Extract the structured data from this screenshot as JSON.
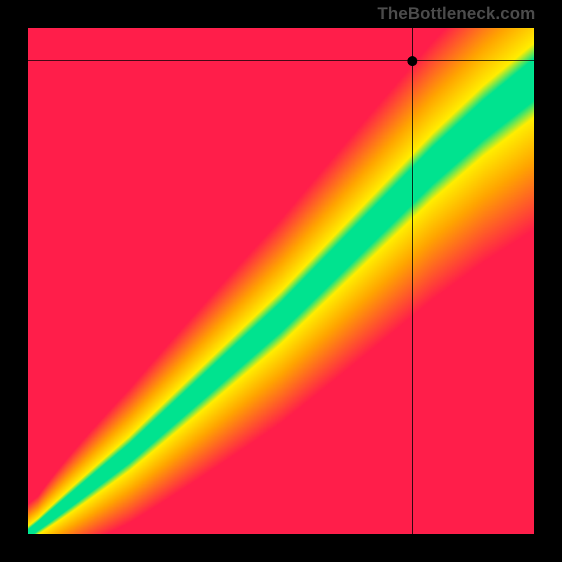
{
  "watermark": "TheBottleneck.com",
  "chart_data": {
    "type": "heatmap",
    "title": "",
    "xlabel": "",
    "ylabel": "",
    "xlim": [
      0,
      1
    ],
    "ylim": [
      0,
      1
    ],
    "legend": false,
    "grid": false,
    "colorscale": {
      "low": "#ff1e4a",
      "mid1": "#ffa500",
      "mid2": "#ffee00",
      "optimal": "#00e38f",
      "high": "#ff1e4a"
    },
    "description": "Bottleneck heatmap: color encodes distance of actual GPU requirement from the optimal CPU/GPU pairing diagonal. Green = balanced, yellow = moderate bottleneck, red = severe bottleneck.",
    "optimal_band": {
      "comment": "Green optimal band follows a slightly super-linear diagonal from (0,0) toward (1,1), curving so that higher-end CPUs tolerate proportionally higher GPUs.",
      "center_points_xy": [
        [
          0.0,
          0.0
        ],
        [
          0.1,
          0.08
        ],
        [
          0.2,
          0.16
        ],
        [
          0.3,
          0.25
        ],
        [
          0.4,
          0.34
        ],
        [
          0.5,
          0.43
        ],
        [
          0.6,
          0.53
        ],
        [
          0.7,
          0.63
        ],
        [
          0.8,
          0.73
        ],
        [
          0.9,
          0.82
        ],
        [
          1.0,
          0.9
        ]
      ],
      "half_width_fraction": 0.05
    },
    "crosshair": {
      "x": 0.76,
      "y": 0.935,
      "note": "Selected CPU/GPU pair — falls in yellow region (moderate GPU bottleneck / GPU overpowered for CPU)."
    }
  }
}
